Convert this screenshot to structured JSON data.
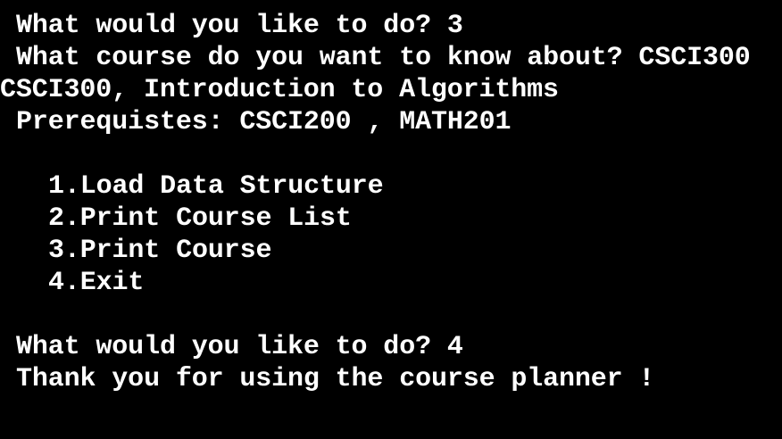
{
  "terminal": {
    "background": "#000000",
    "foreground": "#ffffff",
    "prompt1": "What would you like to do? 3",
    "prompt2": "What course do you want to know about? CSCI300",
    "course_title": "CSCI300, Introduction to Algorithms",
    "prerequisites": "Prerequistes: CSCI200 , MATH201",
    "menu": [
      "1.Load Data Structure",
      "2.Print Course List",
      "3.Print Course",
      "4.Exit"
    ],
    "prompt3": "What would you like to do? 4",
    "goodbye": "Thank you for using the course planner !"
  }
}
